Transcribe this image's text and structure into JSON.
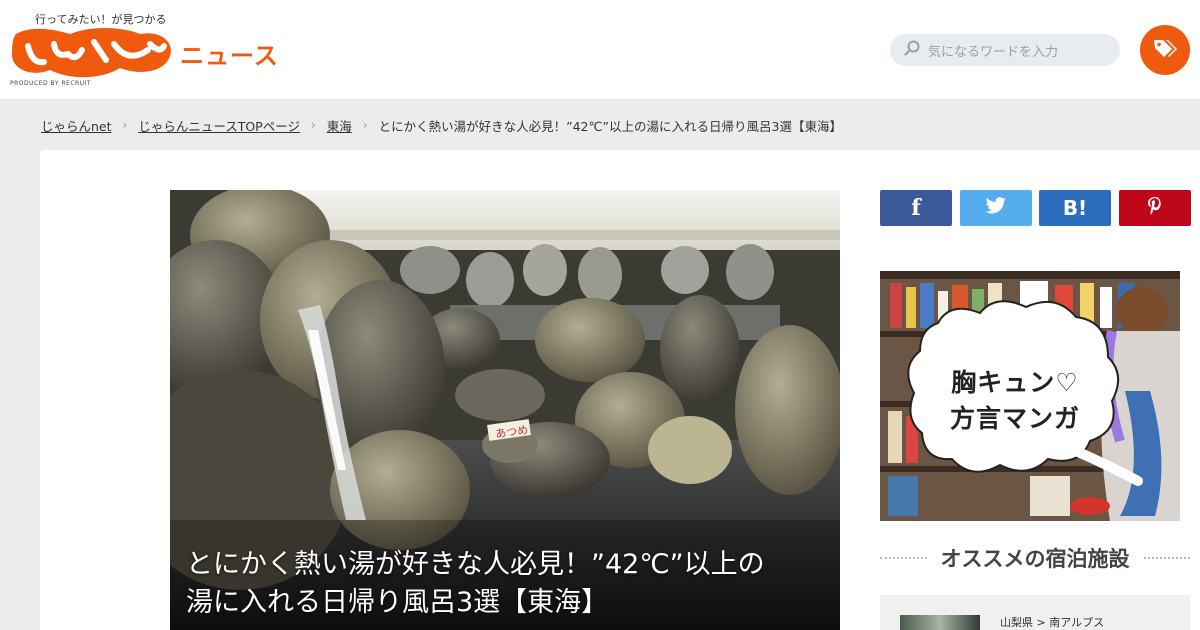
{
  "header": {
    "tagline": "行ってみたい！が見つかる",
    "logo_text": "じゃらん",
    "logo_sub": "ニュース",
    "produced_by": "PRODUCED BY RECRUIT",
    "search_placeholder": "気になるワードを入力"
  },
  "breadcrumb": {
    "items": [
      "じゃらんnet",
      "じゃらんニュースTOPページ",
      "東海"
    ],
    "current": "とにかく熱い湯が好きな人必見！”42℃”以上の湯に入れる日帰り風呂3選【東海】"
  },
  "article": {
    "title_line1": "とにかく熱い湯が好きな人必見！”42℃”以上の",
    "title_line2": "湯に入れる日帰り風呂3選【東海】",
    "sign_text": "あつめ"
  },
  "share": {
    "facebook": "f",
    "hatena": "B!"
  },
  "banner": {
    "line1": "胸キュン♡",
    "line2": "方言マンガ"
  },
  "sidebar": {
    "section_title": "オススメの宿泊施設",
    "recommend_location": "山梨県 > 南アルプス"
  },
  "colors": {
    "brand": "#f05a0e",
    "facebook": "#3b5998",
    "twitter": "#55acee",
    "hatena": "#2c6ebd",
    "pinterest": "#bd081c"
  }
}
